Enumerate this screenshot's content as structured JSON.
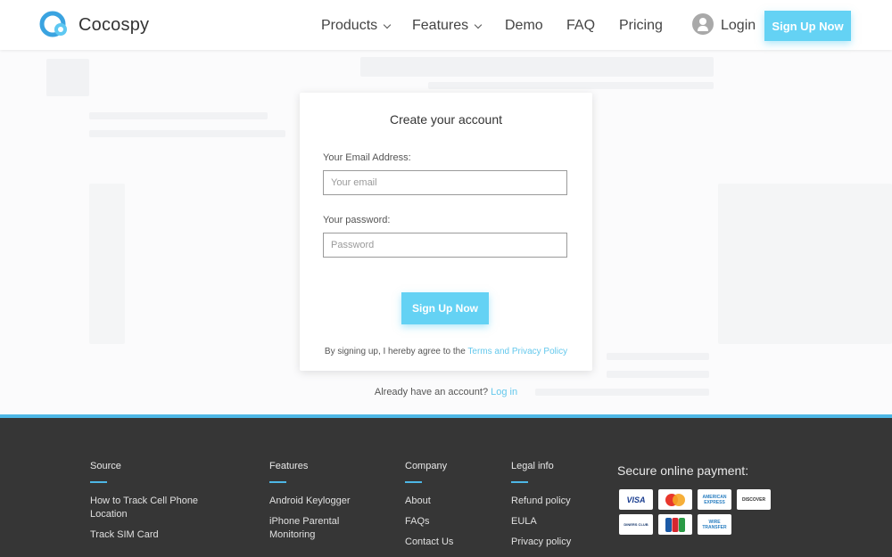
{
  "brand": {
    "name": "Cocospy"
  },
  "nav": {
    "products": "Products",
    "features": "Features",
    "demo": "Demo",
    "faq": "FAQ",
    "pricing": "Pricing",
    "login": "Login",
    "signup": "Sign Up Now"
  },
  "form": {
    "title": "Create your account",
    "email_label": "Your Email Address:",
    "email_placeholder": "Your email",
    "password_label": "Your password:",
    "password_placeholder": "Password",
    "submit": "Sign Up Now",
    "terms_prefix": "By signing up, I hereby agree to the ",
    "terms_link": "Terms and Privacy Policy",
    "already_prefix": "Already have an account? ",
    "login_link": "Log in"
  },
  "footer": {
    "source": {
      "heading": "Source",
      "links": [
        "How to Track Cell Phone Location",
        "Track SIM Card"
      ]
    },
    "features": {
      "heading": "Features",
      "links": [
        "Android Keylogger",
        "iPhone Parental Monitoring"
      ]
    },
    "company": {
      "heading": "Company",
      "links": [
        "About",
        "FAQs",
        "Contact Us"
      ]
    },
    "legal": {
      "heading": "Legal info",
      "links": [
        "Refund policy",
        "EULA",
        "Privacy policy"
      ]
    },
    "payment": {
      "title": "Secure online payment:",
      "methods": [
        "VISA",
        "MasterCard",
        "AMERICAN EXPRESS",
        "DISCOVER",
        "DINERS CLUB",
        "JCB",
        "WIRE TRANSFER"
      ]
    }
  },
  "colors": {
    "accent": "#64d2f4",
    "footer_bg": "#363636",
    "footer_bar": "#4db7e6"
  }
}
